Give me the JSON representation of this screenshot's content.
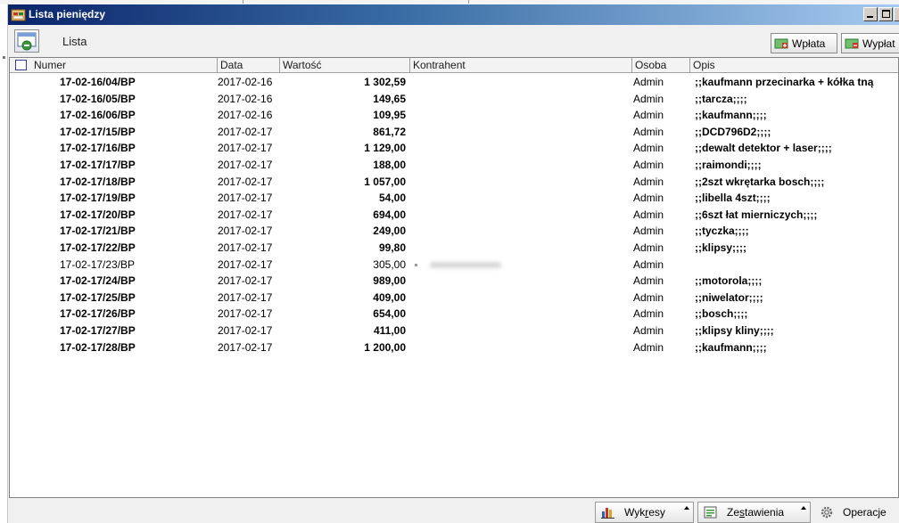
{
  "window": {
    "title": "Lista pieniędzy"
  },
  "toolbar": {
    "label": "Lista",
    "wplata_label": "Wpłata",
    "wyplata_label": "Wypłat"
  },
  "columns": [
    "Numer",
    "Data",
    "Wartość",
    "Kontrahent",
    "Osoba",
    "Opis"
  ],
  "rows": [
    {
      "numer": "17-02-16/04/BP",
      "data": "2017-02-16",
      "wartosc": "1 302,59",
      "kontrahent": "",
      "osoba": "Admin",
      "opis": ";;kaufmann przecinarka + kółka tną",
      "bold": true
    },
    {
      "numer": "17-02-16/05/BP",
      "data": "2017-02-16",
      "wartosc": "149,65",
      "kontrahent": "",
      "osoba": "Admin",
      "opis": ";;tarcza;;;;",
      "bold": true
    },
    {
      "numer": "17-02-16/06/BP",
      "data": "2017-02-16",
      "wartosc": "109,95",
      "kontrahent": "",
      "osoba": "Admin",
      "opis": ";;kaufmann;;;;",
      "bold": true
    },
    {
      "numer": "17-02-17/15/BP",
      "data": "2017-02-17",
      "wartosc": "861,72",
      "kontrahent": "",
      "osoba": "Admin",
      "opis": ";;DCD796D2;;;;",
      "bold": true
    },
    {
      "numer": "17-02-17/16/BP",
      "data": "2017-02-17",
      "wartosc": "1 129,00",
      "kontrahent": "",
      "osoba": "Admin",
      "opis": ";;dewalt detektor + laser;;;;",
      "bold": true
    },
    {
      "numer": "17-02-17/17/BP",
      "data": "2017-02-17",
      "wartosc": "188,00",
      "kontrahent": "",
      "osoba": "Admin",
      "opis": ";;raimondi;;;;",
      "bold": true
    },
    {
      "numer": "17-02-17/18/BP",
      "data": "2017-02-17",
      "wartosc": "1 057,00",
      "kontrahent": "",
      "osoba": "Admin",
      "opis": ";;2szt wkrętarka bosch;;;;",
      "bold": true
    },
    {
      "numer": "17-02-17/19/BP",
      "data": "2017-02-17",
      "wartosc": "54,00",
      "kontrahent": "",
      "osoba": "Admin",
      "opis": ";;libella 4szt;;;;",
      "bold": true
    },
    {
      "numer": "17-02-17/20/BP",
      "data": "2017-02-17",
      "wartosc": "694,00",
      "kontrahent": "",
      "osoba": "Admin",
      "opis": ";;6szt łat mierniczych;;;;",
      "bold": true
    },
    {
      "numer": "17-02-17/21/BP",
      "data": "2017-02-17",
      "wartosc": "249,00",
      "kontrahent": "",
      "osoba": "Admin",
      "opis": ";;tyczka;;;;",
      "bold": true
    },
    {
      "numer": "17-02-17/22/BP",
      "data": "2017-02-17",
      "wartosc": "99,80",
      "kontrahent": "",
      "osoba": "Admin",
      "opis": ";;klipsy;;;;",
      "bold": true
    },
    {
      "numer": "17-02-17/23/BP",
      "data": "2017-02-17",
      "wartosc": "305,00",
      "kontrahent": "",
      "osoba": "Admin",
      "opis": "",
      "bold": false,
      "blurred": true
    },
    {
      "numer": "17-02-17/24/BP",
      "data": "2017-02-17",
      "wartosc": "989,00",
      "kontrahent": "",
      "osoba": "Admin",
      "opis": ";;motorola;;;;",
      "bold": true
    },
    {
      "numer": "17-02-17/25/BP",
      "data": "2017-02-17",
      "wartosc": "409,00",
      "kontrahent": "",
      "osoba": "Admin",
      "opis": ";;niwelator;;;;",
      "bold": true
    },
    {
      "numer": "17-02-17/26/BP",
      "data": "2017-02-17",
      "wartosc": "654,00",
      "kontrahent": "",
      "osoba": "Admin",
      "opis": ";;bosch;;;;",
      "bold": true
    },
    {
      "numer": "17-02-17/27/BP",
      "data": "2017-02-17",
      "wartosc": "411,00",
      "kontrahent": "",
      "osoba": "Admin",
      "opis": ";;klipsy kliny;;;;",
      "bold": true
    },
    {
      "numer": "17-02-17/28/BP",
      "data": "2017-02-17",
      "wartosc": "1 200,00",
      "kontrahent": "",
      "osoba": "Admin",
      "opis": ";;kaufmann;;;;",
      "bold": true
    }
  ],
  "bottombar": {
    "wykresy_pre": "Wyk",
    "wykresy_ul": "r",
    "wykresy_post": "esy",
    "zestawienia_pre": "Ze",
    "zestawienia_ul": "s",
    "zestawienia_post": "tawienia",
    "operacje_label": "Operacje"
  },
  "colors": {
    "title_start": "#0a246a",
    "title_end": "#a6caf0",
    "accent_green": "#3a9a3a"
  }
}
